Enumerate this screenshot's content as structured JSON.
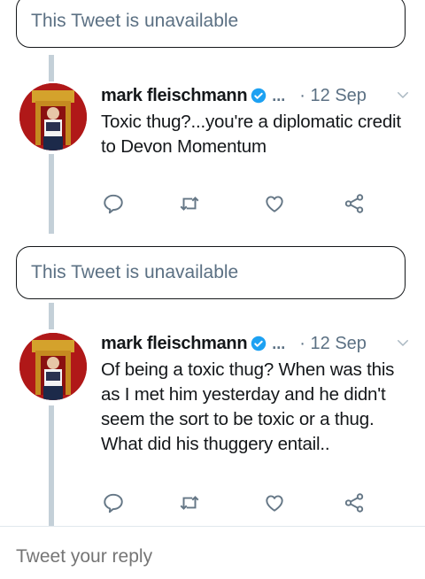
{
  "colors": {
    "text": "#14171a",
    "muted": "#5b7083",
    "verified": "#1da1f2",
    "thread_line": "#c4d0d8",
    "avatar_bg": "#b01818"
  },
  "unavailable_notices": [
    {
      "text": "This Tweet is unavailable"
    },
    {
      "text": "This Tweet is unavailable"
    }
  ],
  "tweets": [
    {
      "author": "mark fleischmann",
      "handle": "...",
      "date": "· 12 Sep",
      "text": "Toxic thug?...you're a diplomatic credit to Devon Momentum",
      "icons": [
        "reply-icon",
        "retweet-icon",
        "like-icon",
        "share-icon"
      ]
    },
    {
      "author": "mark fleischmann",
      "handle": "...",
      "date": "· 12 Sep",
      "text": "Of being a toxic thug? When was this as I met him yesterday and he didn't seem the sort to be toxic or a thug. What did his thuggery entail..",
      "icons": [
        "reply-icon",
        "retweet-icon",
        "like-icon",
        "share-icon"
      ]
    }
  ],
  "reply_bar": {
    "placeholder": "Tweet your reply"
  }
}
